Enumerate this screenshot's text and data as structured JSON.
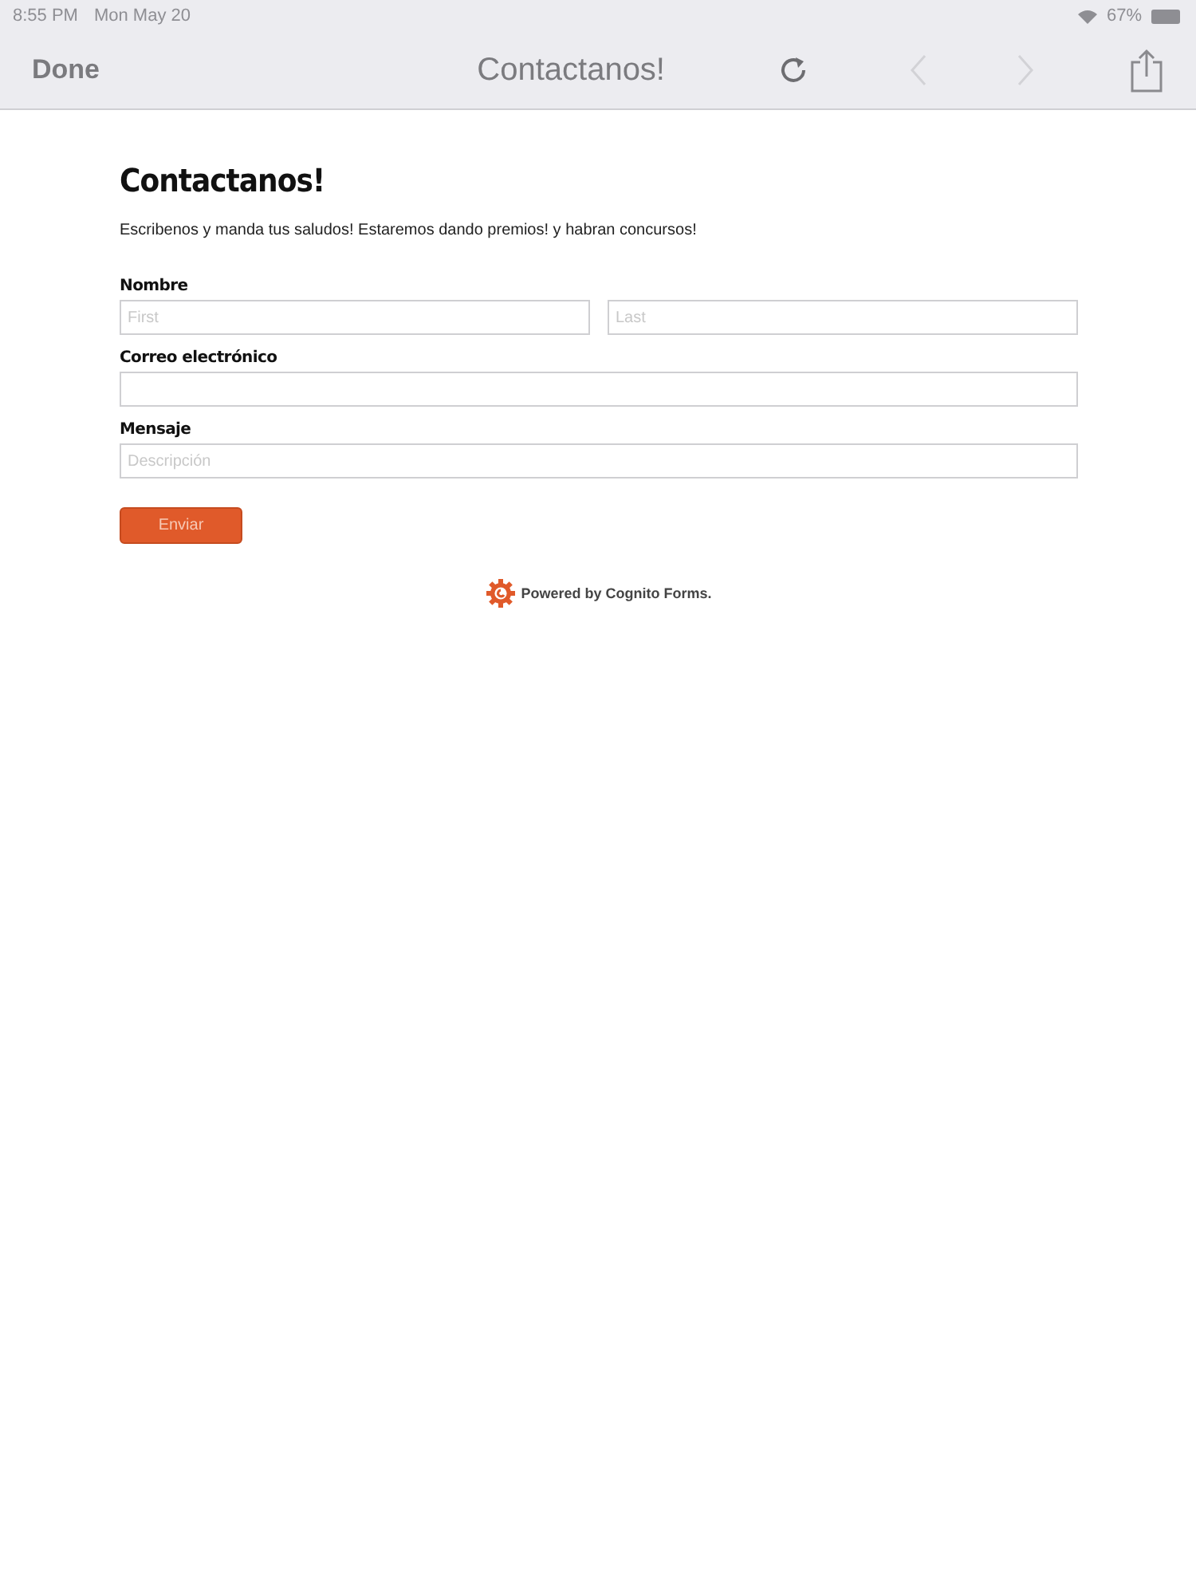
{
  "status_bar": {
    "time": "8:55 PM",
    "date": "Mon May 20",
    "battery": "67%"
  },
  "nav_bar": {
    "done": "Done",
    "title": "Contactanos!",
    "back_disabled": true,
    "forward_disabled": true
  },
  "form": {
    "title": "Contactanos!",
    "description": "Escribenos y manda tus saludos! Estaremos dando premios! y habran concursos!",
    "fields": [
      {
        "label": "Nombre",
        "kind": "split",
        "placeholders": [
          "First",
          "Last"
        ]
      },
      {
        "label": "Correo electrónico",
        "kind": "single"
      },
      {
        "label": "Mensaje",
        "kind": "single",
        "placeholders": [
          "Descripción"
        ]
      }
    ],
    "submit": "Enviar"
  },
  "footer": {
    "text": "Powered by Cognito Forms."
  }
}
